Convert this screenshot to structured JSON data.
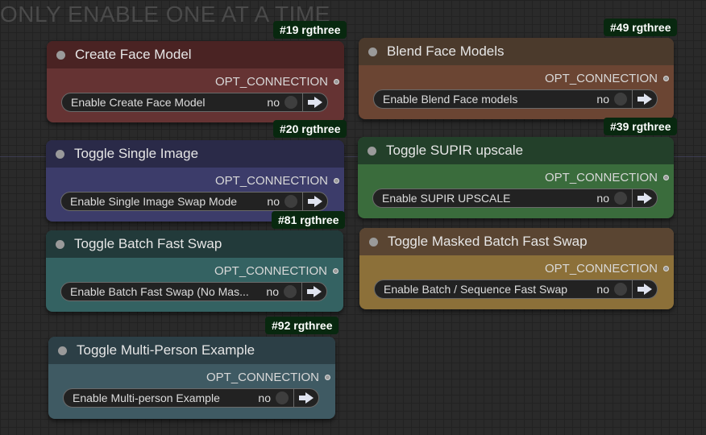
{
  "group": {
    "title": "ONLY ENABLE ONE AT A TIME"
  },
  "colors": {
    "red": {
      "header": "#4a2323",
      "body": "#653333"
    },
    "blue": {
      "header": "#2a2a48",
      "body": "#3c3c6a"
    },
    "teal": {
      "header": "#223a3a",
      "body": "#346262"
    },
    "slate": {
      "header": "#2c3f46",
      "body": "#3f5a63"
    },
    "brown": {
      "header": "#4b3a2c",
      "body": "#6b4533"
    },
    "green": {
      "header": "#23402a",
      "body": "#3a6c3c"
    },
    "tan": {
      "header": "#5a4532",
      "body": "#8c7039"
    }
  },
  "nodes": [
    {
      "id": "#19 rgthree",
      "title": "Create Face Model",
      "output": "OPT_CONNECTION",
      "widget_label": "Enable Create Face Model",
      "value": "no"
    },
    {
      "id": "#20 rgthree",
      "title": "Toggle Single Image",
      "output": "OPT_CONNECTION",
      "widget_label": "Enable Single Image Swap Mode",
      "value": "no"
    },
    {
      "id": "#81 rgthree",
      "title": "Toggle Batch Fast Swap",
      "output": "OPT_CONNECTION",
      "widget_label": "Enable Batch Fast Swap (No Mas...",
      "value": "no"
    },
    {
      "id": "#92 rgthree",
      "title": "Toggle Multi-Person Example",
      "output": "OPT_CONNECTION",
      "widget_label": "Enable Multi-person Example",
      "value": "no"
    },
    {
      "id": "#49 rgthree",
      "title": "Blend Face Models",
      "output": "OPT_CONNECTION",
      "widget_label": "Enable Blend Face models",
      "value": "no"
    },
    {
      "id": "#39 rgthree",
      "title": "Toggle SUPIR upscale",
      "output": "OPT_CONNECTION",
      "widget_label": "Enable SUPIR UPSCALE",
      "value": "no"
    },
    {
      "id": "",
      "title": "Toggle Masked Batch Fast Swap",
      "output": "OPT_CONNECTION",
      "widget_label": "Enable Batch / Sequence Fast Swap",
      "value": "no"
    }
  ]
}
